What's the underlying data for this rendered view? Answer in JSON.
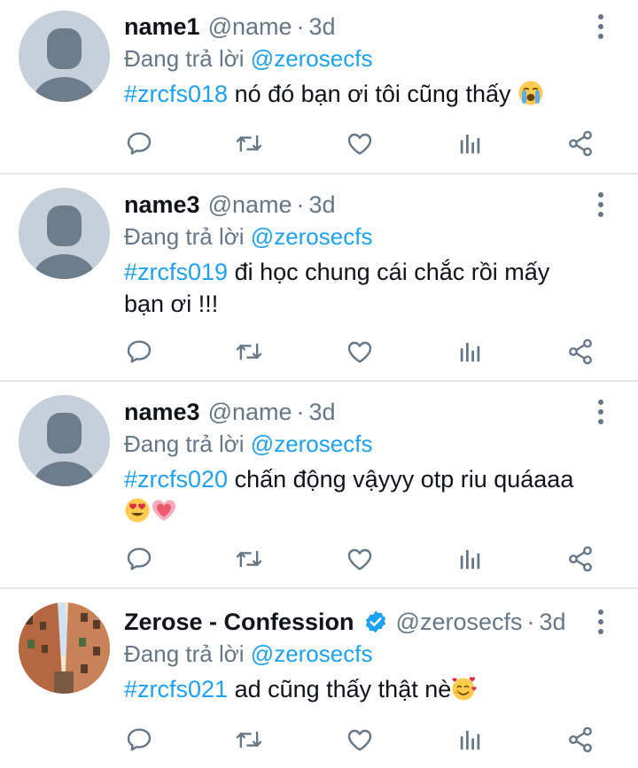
{
  "tweets": [
    {
      "name": "name1",
      "handle": "@name",
      "separator": "·",
      "time": "3d",
      "reply_prefix": "Đang trả lời",
      "reply_to": "@zerosecfs",
      "hashtag": "#zrcfs018",
      "text": " nó đó bạn ơi tôi cũng thấy ",
      "emojis": [
        "loudly-crying-face-emoji"
      ]
    },
    {
      "name": "name3",
      "handle": "@name",
      "separator": "·",
      "time": "3d",
      "reply_prefix": "Đang trả lời",
      "reply_to": "@zerosecfs",
      "hashtag": "#zrcfs019",
      "text": " đi học chung cái chắc rồi mấy bạn ơi !!!",
      "emojis": []
    },
    {
      "name": "name3",
      "handle": "@name",
      "separator": "·",
      "time": "3d",
      "reply_prefix": "Đang trả lời",
      "reply_to": "@zerosecfs",
      "hashtag": "#zrcfs020",
      "text": " chấn động vậyyy otp riu quáaaa",
      "emojis": [
        "heart-eyes-emoji",
        "growing-heart-emoji"
      ]
    },
    {
      "name": "Zerose - Confession",
      "verified": true,
      "handle": "@zerosecfs",
      "separator": "·",
      "time": "3d",
      "reply_prefix": "Đang trả lời",
      "reply_to": "@zerosecfs",
      "hashtag": "#zrcfs021",
      "text": " ad cũng thấy thật nè",
      "emojis": [
        "smiling-face-with-hearts-emoji"
      ]
    }
  ],
  "actions": [
    "reply-icon",
    "retweet-icon",
    "like-icon",
    "analytics-icon",
    "share-icon"
  ],
  "colors": {
    "link": "#1da1f2",
    "muted": "#657786",
    "text": "#0f1419",
    "avatar_placeholder": "#c6d0d8",
    "avatar_silhouette": "#6e7d8c",
    "divider": "#e3e7ea"
  }
}
